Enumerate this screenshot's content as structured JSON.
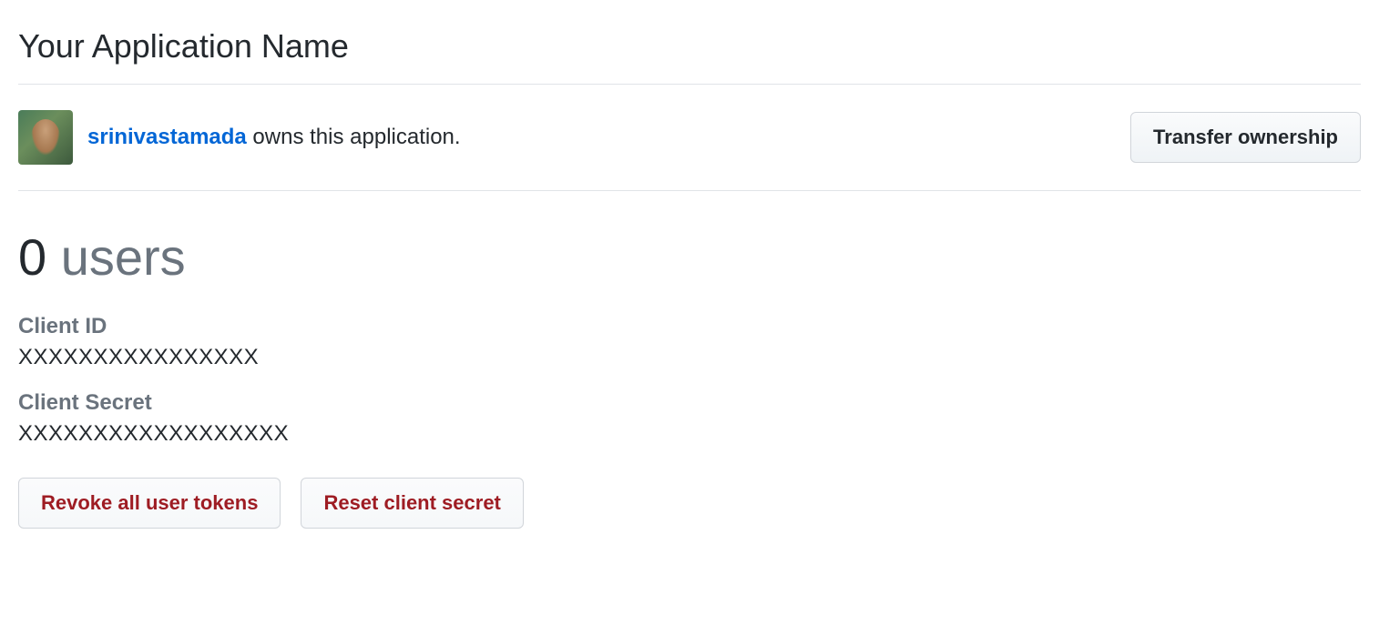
{
  "header": {
    "title": "Your Application Name"
  },
  "owner": {
    "username": "srinivastamada",
    "owns_text": " owns this application.",
    "transfer_button": "Transfer ownership"
  },
  "stats": {
    "count": "0",
    "label": " users"
  },
  "credentials": {
    "client_id_label": "Client ID",
    "client_id_value": "XXXXXXXXXXXXXXXX",
    "client_secret_label": "Client Secret",
    "client_secret_value": "XXXXXXXXXXXXXXXXXX"
  },
  "actions": {
    "revoke_tokens": "Revoke all user tokens",
    "reset_secret": "Reset client secret"
  }
}
